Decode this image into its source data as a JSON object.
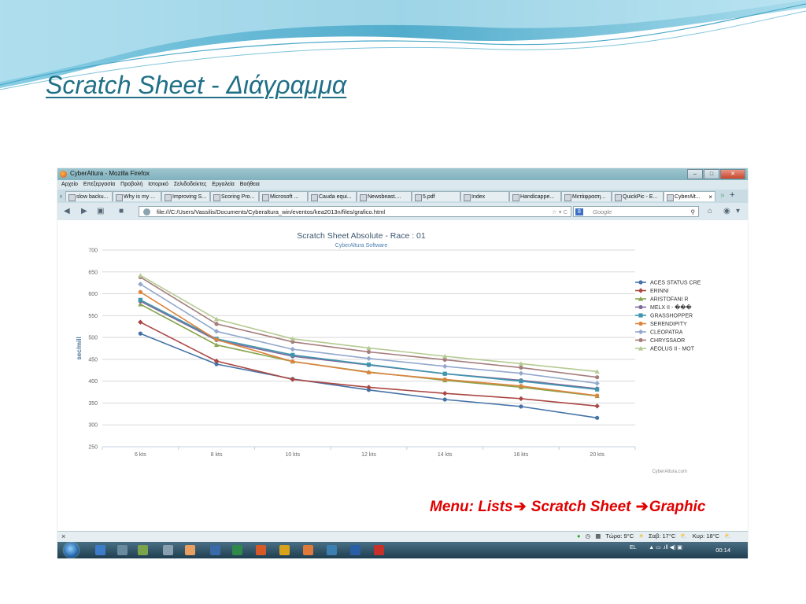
{
  "slide": {
    "title": "Scratch Sheet - Διάγραμμα",
    "caption_part1": "Menu: Lists",
    "caption_part2": " Scratch Sheet ",
    "caption_part3": "Graphic",
    "arrow_icon": "➔",
    "colors": {
      "title": "#1f6f86",
      "caption": "#e00000",
      "wave": "#3ea3c6"
    }
  },
  "browser": {
    "window_title": "CyberAltura - Mozilla Firefox",
    "window_buttons": [
      "–",
      "□",
      "✕"
    ],
    "menu": [
      "Αρχείο",
      "Επεξεργασία",
      "Προβολή",
      "Ιστορικό",
      "Σελιδοδείκτες",
      "Εργαλεία",
      "Βοήθεια"
    ],
    "tabs": [
      {
        "label": "slow backu..."
      },
      {
        "label": "Why is my ..."
      },
      {
        "label": "Improving S..."
      },
      {
        "label": "Scoring Pro..."
      },
      {
        "label": "Microsoft ..."
      },
      {
        "label": "Cauda equi..."
      },
      {
        "label": "Newsbeast...."
      },
      {
        "label": "5.pdf"
      },
      {
        "label": "Index"
      },
      {
        "label": "Handicappe..."
      },
      {
        "label": "Μετάφραση..."
      },
      {
        "label": "QuickPic - E..."
      },
      {
        "label": "CyberAlt..."
      }
    ],
    "url": "file:///C:/Users/Vassilis/Documents/Cyberaltura_win/eventos/kea2013n/files/grafico.html",
    "search_placeholder": "Google",
    "status_weather": [
      "Τώρα: 9°C",
      "Σαβ: 17°C",
      "Κυρ: 18°C"
    ],
    "taskbar_lang": "EL",
    "taskbar_time": "00:14"
  },
  "chart_data": {
    "type": "line",
    "title": "Scratch Sheet Absolute - Race : 01",
    "subtitle": "CyberAltura Software",
    "xlabel": "",
    "ylabel": "sec/mill",
    "ylim": [
      250,
      700
    ],
    "yticks": [
      250,
      300,
      350,
      400,
      450,
      500,
      550,
      600,
      650,
      700
    ],
    "categories": [
      "6 kts",
      "8 kts",
      "10 kts",
      "12 kts",
      "14 kts",
      "16 kts",
      "20 kts"
    ],
    "grid": true,
    "legend_position": "right",
    "credit": "CyberAltura.com",
    "series": [
      {
        "name": "ACES STATUS CRE",
        "color": "#4572a7",
        "marker": "circle",
        "values": [
          509,
          439,
          405,
          380,
          358,
          342,
          316
        ]
      },
      {
        "name": "ERINNI",
        "color": "#aa4643",
        "marker": "diamond",
        "values": [
          535,
          446,
          404,
          386,
          372,
          360,
          343
        ]
      },
      {
        "name": "ARISTOFANI R",
        "color": "#89a54e",
        "marker": "triangle",
        "values": [
          576,
          483,
          445,
          421,
          402,
          386,
          366
        ]
      },
      {
        "name": "MELX II - ���",
        "color": "#80699b",
        "marker": "circle",
        "values": [
          583,
          494,
          457,
          437,
          417,
          402,
          383
        ]
      },
      {
        "name": "GRASSHOPPER",
        "color": "#3d96ae",
        "marker": "square",
        "values": [
          586,
          497,
          460,
          438,
          417,
          400,
          381
        ]
      },
      {
        "name": "SERENDIPITY",
        "color": "#db843d",
        "marker": "circle",
        "values": [
          604,
          495,
          445,
          420,
          404,
          389,
          367
        ]
      },
      {
        "name": "CLEOPATRA",
        "color": "#92a8cd",
        "marker": "diamond",
        "values": [
          622,
          514,
          473,
          452,
          434,
          418,
          395
        ]
      },
      {
        "name": "CHRYSSAOR",
        "color": "#a47d7c",
        "marker": "circle",
        "values": [
          638,
          531,
          490,
          467,
          449,
          431,
          409
        ]
      },
      {
        "name": "AEOLUS II - MOT",
        "color": "#b5ca92",
        "marker": "triangle",
        "values": [
          642,
          542,
          497,
          476,
          457,
          440,
          422
        ]
      }
    ]
  }
}
